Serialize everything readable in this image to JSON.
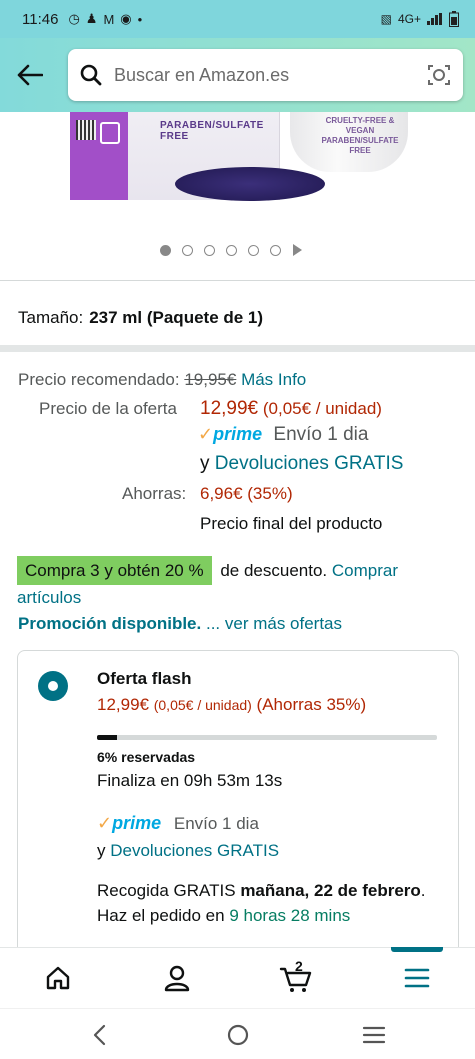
{
  "status_bar": {
    "time": "11:46",
    "left_icons": [
      "whatsapp-icon",
      "person-icon",
      "gmail-icon",
      "chrome-icon",
      "dot-icon"
    ],
    "network": "4G+",
    "right_icons": [
      "vibrate-icon",
      "signal-icon",
      "battery-icon"
    ]
  },
  "header": {
    "search_placeholder": "Buscar en Amazon.es",
    "colors": {
      "gradient_start": "#83dada",
      "gradient_end": "#a2e6c7"
    }
  },
  "product_image": {
    "box_text": "PARABEN/SULFATE FREE",
    "bottle_text_1": "CRUELTY-FREE & VEGAN",
    "bottle_text_2": "PARABEN/SULFATE FREE"
  },
  "carousel": {
    "dots": 6,
    "active_index": 0
  },
  "size": {
    "label": "Tamaño:",
    "value": "237 ml (Paquete de 1)"
  },
  "pricing": {
    "recommended_label": "Precio recomendado:",
    "recommended_price": "19,95€",
    "more_info": "Más Info",
    "offer_label": "Precio de la oferta",
    "offer_price": "12,99€",
    "unit_price": "(0,05€ / unidad)",
    "prime_check": "✓",
    "prime_word": "prime",
    "shipping": "Envío 1 dia",
    "and": "y",
    "returns": "Devoluciones GRATIS",
    "savings_label": "Ahorras:",
    "savings_value": "6,96€ (35%)",
    "final_price": "Precio final del producto"
  },
  "promotion": {
    "badge": "Compra 3 y obtén 20 %",
    "rest": "de descuento.",
    "link": "Comprar artículos",
    "available": "Promoción disponible.",
    "more_offers": "... ver más ofertas"
  },
  "offer_card": {
    "title": "Oferta flash",
    "price": "12,99€",
    "unit_price": "(0,05€ / unidad)",
    "savings": "(Ahorras 35%)",
    "progress_fraction": 0.06,
    "reserved": "6% reservadas",
    "ends": "Finaliza en 09h 53m 13s",
    "prime_check": "✓",
    "prime_word": "prime",
    "shipping": "Envío 1 dia",
    "and": "y",
    "returns": "Devoluciones GRATIS",
    "pickup_1": "Recogida GRATIS",
    "pickup_bold": "mañana, 22 de febrero",
    "pickup_2": ". Haz el pedido en",
    "pickup_time": "9 horas 28 mins"
  },
  "bottom_nav": {
    "items": [
      "home-icon",
      "account-icon",
      "cart-icon",
      "menu-icon"
    ],
    "cart_count": "2",
    "active": "menu-icon"
  },
  "android_nav": {
    "items": [
      "back-icon",
      "home-circle-icon",
      "recents-icon"
    ]
  }
}
